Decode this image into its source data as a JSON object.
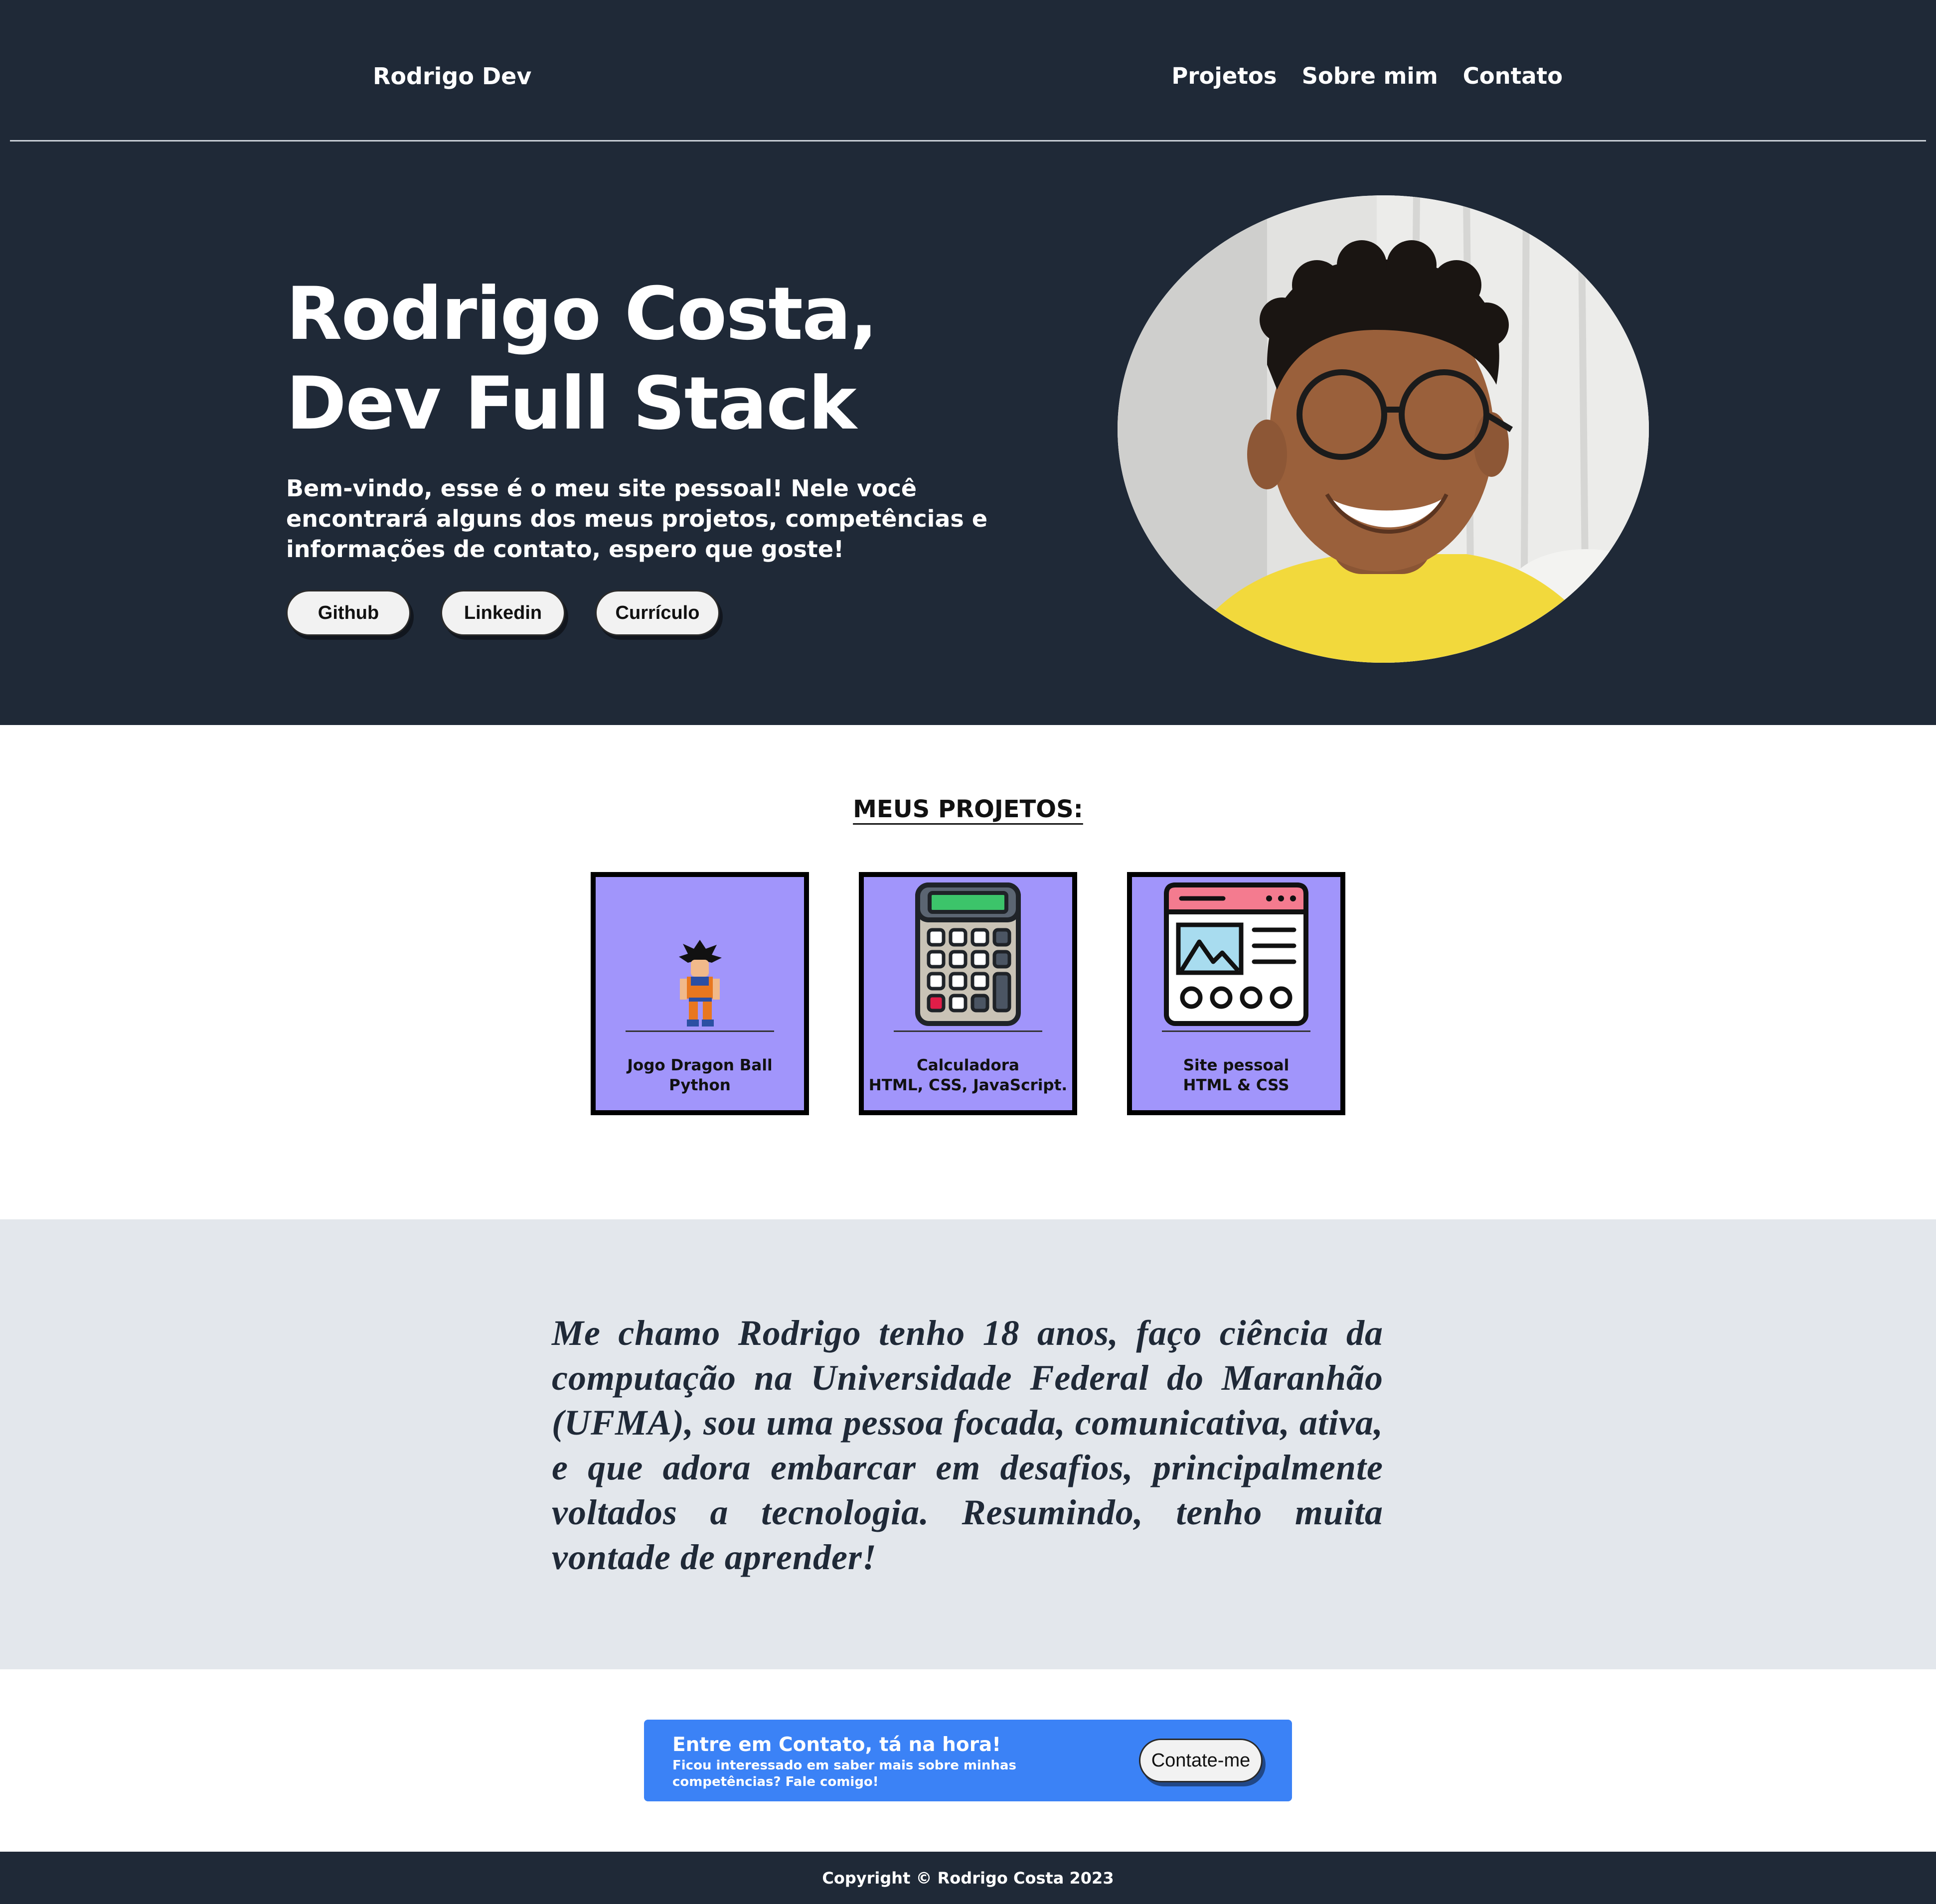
{
  "colors": {
    "header_bg": "#1f2937",
    "card_bg": "#a195fb",
    "about_bg": "#e3e7ec",
    "cta_bg": "#3b82f6"
  },
  "nav": {
    "brand": "Rodrigo Dev",
    "links": [
      "Projetos",
      "Sobre mim",
      "Contato"
    ]
  },
  "hero": {
    "title_line1": "Rodrigo Costa,",
    "title_line2": "Dev Full Stack",
    "subtitle": "Bem-vindo, esse é o meu site pessoal! Nele você encontrará alguns dos meus projetos, competências e informações de contato, espero que goste!",
    "buttons": [
      "Github",
      "Linkedin",
      "Currículo"
    ],
    "photo_icon": "profile-photo"
  },
  "projects": {
    "title": "MEUS PROJETOS:",
    "items": [
      {
        "name": "Jogo Dragon Ball",
        "tech": "Python",
        "icon": "goku-sprite-icon"
      },
      {
        "name": "Calculadora",
        "tech": "HTML, CSS, JavaScript.",
        "icon": "calculator-icon"
      },
      {
        "name": "Site pessoal",
        "tech": "HTML & CSS",
        "icon": "browser-window-icon"
      }
    ]
  },
  "about": {
    "text": "Me chamo Rodrigo tenho 18 anos, faço ciência da computação na Universidade Federal do Maranhão (UFMA), sou uma pessoa focada, comunicativa, ativa, e que adora embarcar em desafios, principalmente voltados a tecnologia. Resumindo, tenho muita vontade de aprender!"
  },
  "cta": {
    "title": "Entre em Contato, tá na hora!",
    "subtitle": "Ficou interessado em saber mais sobre minhas competências? Fale comigo!",
    "button": "Contate-me"
  },
  "footer": {
    "text": "Copyright © Rodrigo Costa 2023"
  }
}
